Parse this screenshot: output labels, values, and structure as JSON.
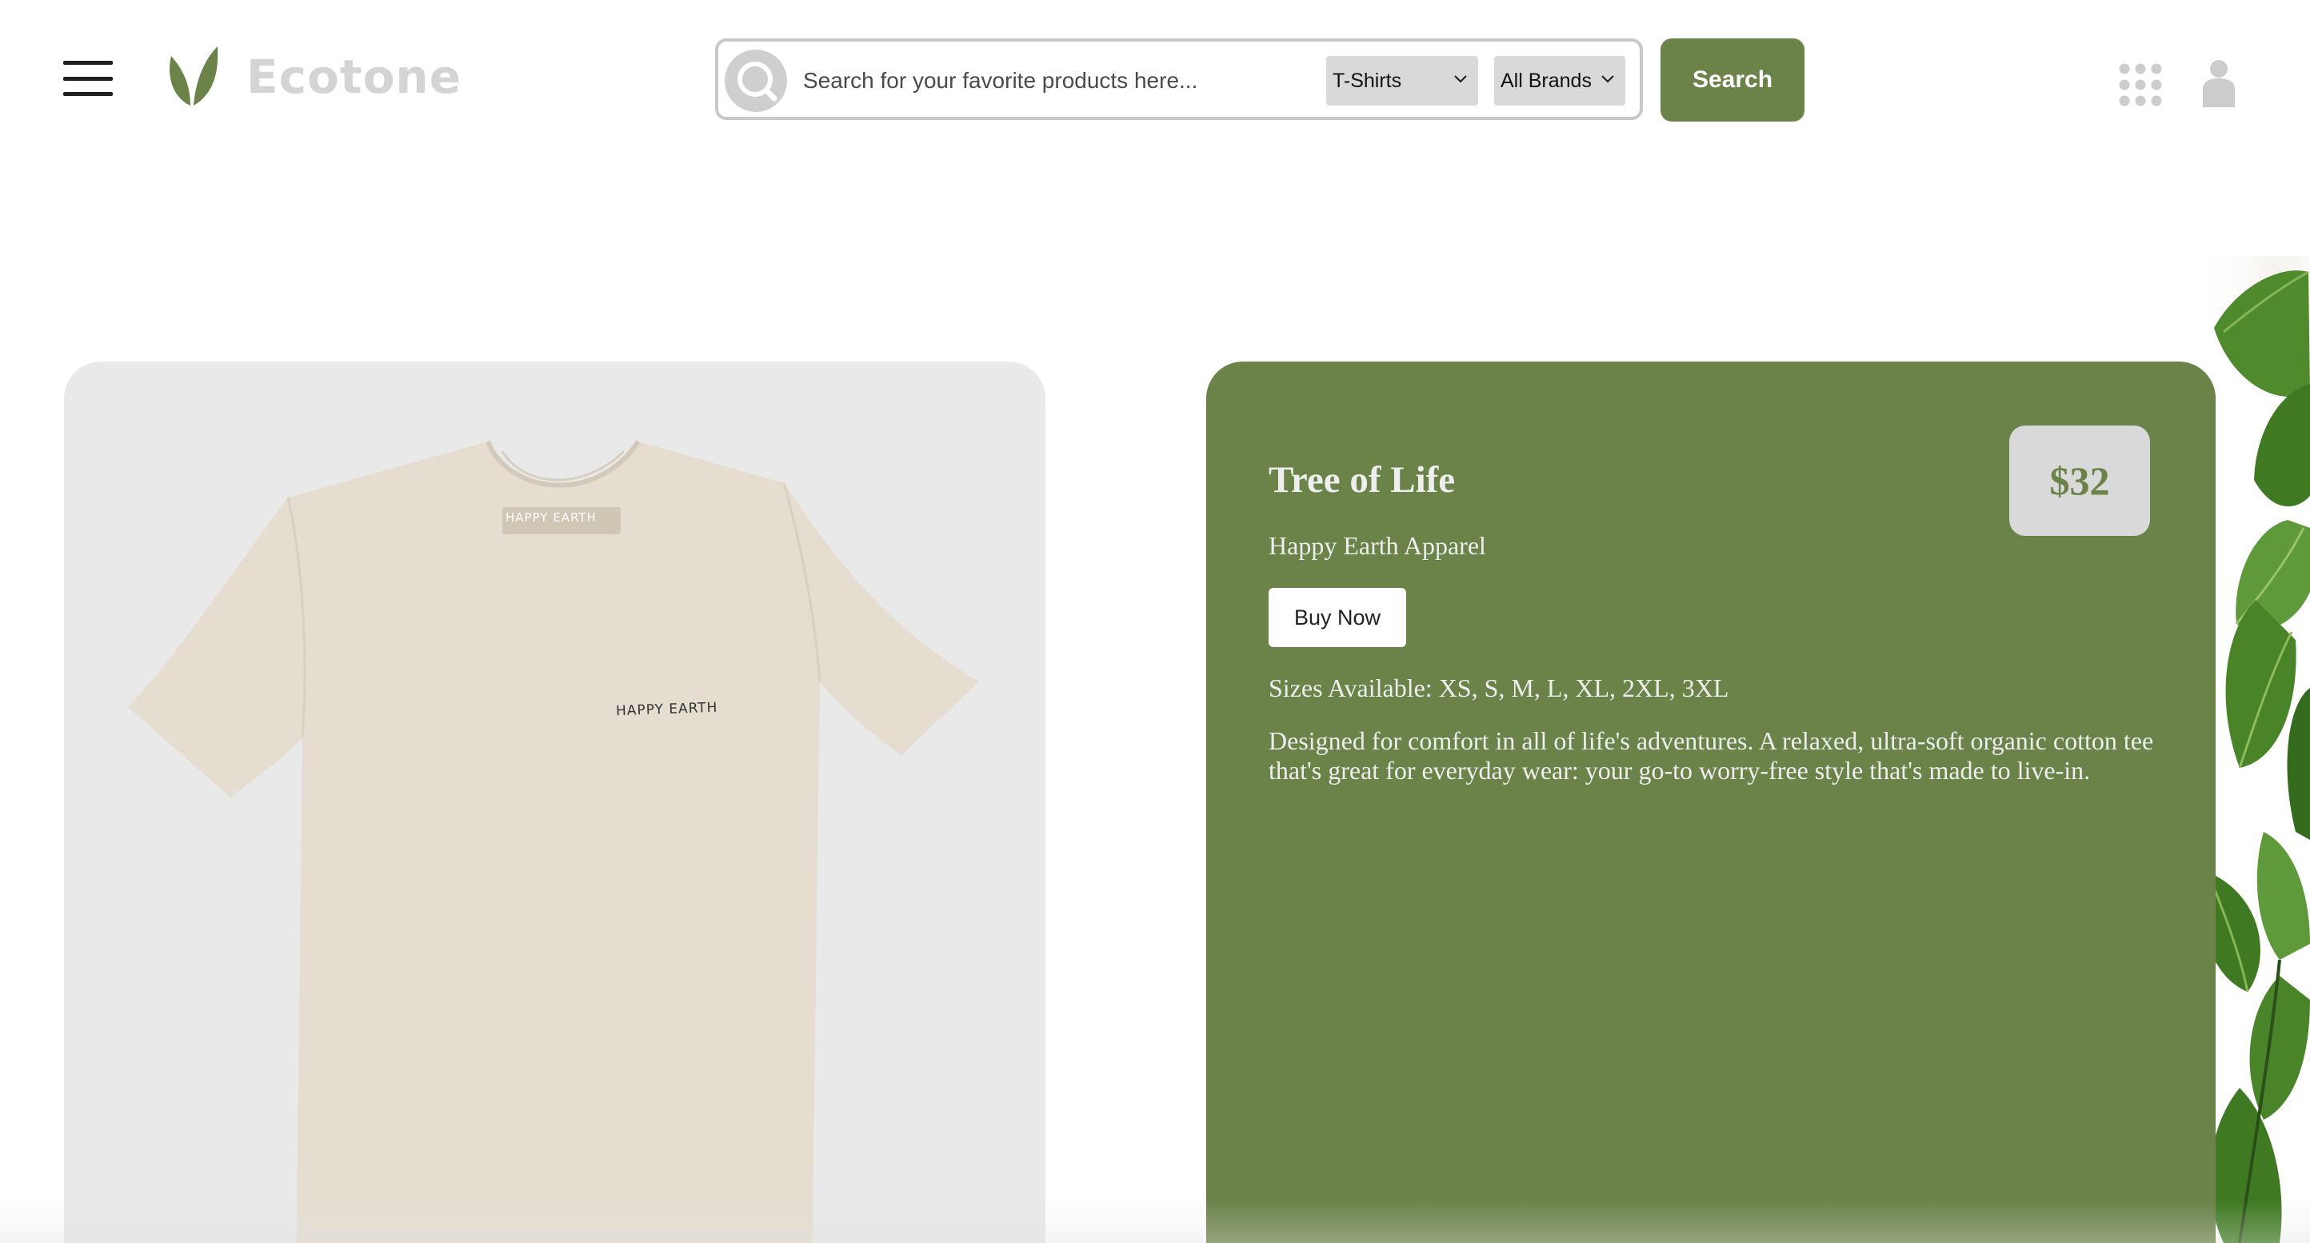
{
  "header": {
    "brand_name": "Ecotone",
    "search": {
      "placeholder": "Search for your favorite products here...",
      "value": "",
      "category_selected": "T-Shirts",
      "brand_selected": "All Brands",
      "button_label": "Search"
    },
    "icons": {
      "menu": "hamburger-menu-icon",
      "logo": "leaf-logo-icon",
      "search": "magnifier-search-icon",
      "apps": "grid-apps-icon",
      "user": "user-profile-icon"
    }
  },
  "product": {
    "title": "Tree of Life",
    "price": "$32",
    "brand": "Happy Earth Apparel",
    "buy_label": "Buy Now",
    "sizes_text": "Sizes Available: XS, S, M, L, XL, 2XL, 3XL",
    "description": "Designed for comfort in all of life's adventures. A relaxed, ultra-soft organic cotton tee that's great for everyday wear: your go-to worry-free style that's made to live-in.",
    "image": {
      "print_text": "HAPPY EARTH",
      "tag_text": "HAPPY EARTH"
    }
  },
  "colors": {
    "accent_green": "#6b8248",
    "logo_gray": "#d4d4d4",
    "price_badge": "#d9d9d9",
    "image_card_bg": "#e9e9e9",
    "shirt": "#e4ddd0"
  }
}
